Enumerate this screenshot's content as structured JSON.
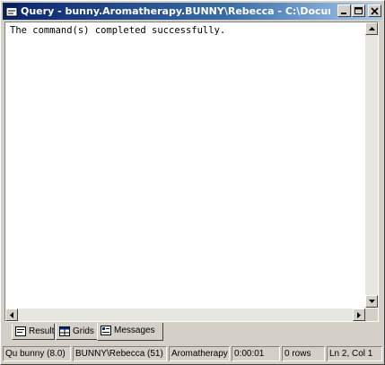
{
  "window": {
    "title": "Query - bunny.Aromatherapy.BUNNY\\Rebecca - C:\\Documents and...",
    "controls": {
      "minimize_icon": "minimize-icon",
      "maximize_icon": "maximize-icon",
      "close_icon": "close-icon"
    },
    "title_gradient_start": "#0a246a",
    "title_gradient_end": "#a6caf0"
  },
  "messages": {
    "text": "The command(s) completed successfully."
  },
  "tabs": [
    {
      "label": "Results",
      "icon": "results-text-icon",
      "active": false
    },
    {
      "label": "Grids",
      "icon": "grid-icon",
      "active": false
    },
    {
      "label": "Messages",
      "icon": "messages-icon",
      "active": true
    }
  ],
  "status": {
    "server": "Qu bunny (8.0)",
    "user": "BUNNY\\Rebecca (51)",
    "database": "Aromatherapy",
    "elapsed": "0:00:01",
    "rows": "0 rows",
    "position": "Ln 2, Col 1"
  }
}
